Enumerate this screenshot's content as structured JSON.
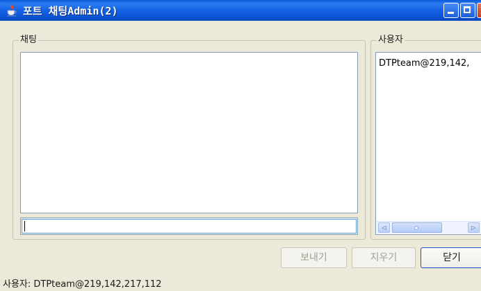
{
  "window": {
    "title": "포트 채팅Admin(2)",
    "icon": "java-cup-icon"
  },
  "chat_group": {
    "label": "채팅",
    "messages": [],
    "input_value": ""
  },
  "users_group": {
    "label": "사용자",
    "users": [
      "DTPteam@219,142,"
    ]
  },
  "buttons": {
    "send": "보내기",
    "clear": "지우기",
    "close": "닫기"
  },
  "status": {
    "text": "사용자: DTPteam@219,142,217,112"
  },
  "colors": {
    "titlebar": "#1563e6",
    "window_bg": "#ece9d8",
    "field_border": "#7f9db9"
  }
}
